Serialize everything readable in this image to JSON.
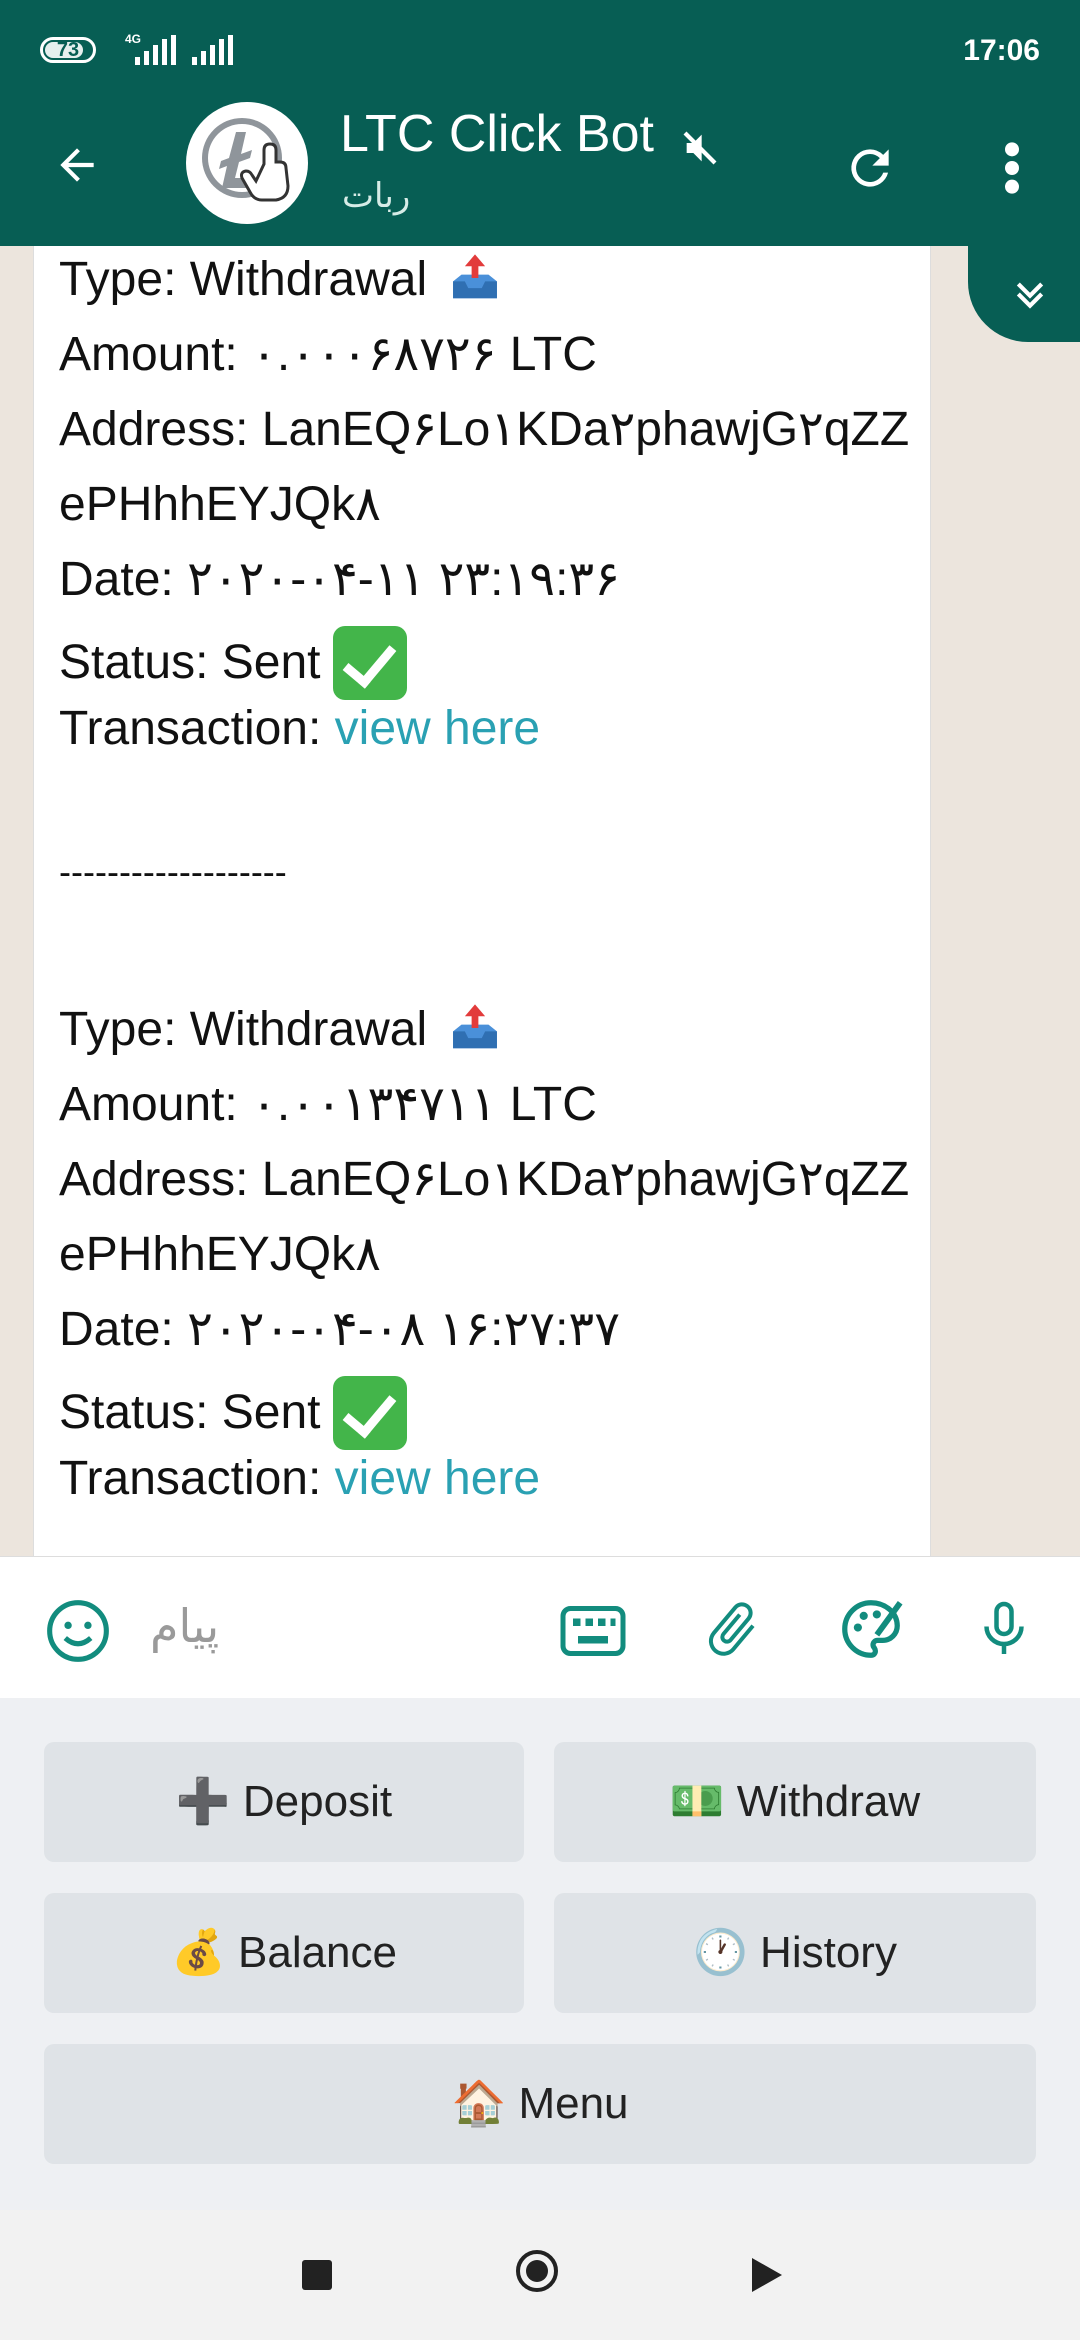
{
  "status_bar": {
    "battery": "73",
    "network": "4G",
    "time": "17:06"
  },
  "header": {
    "title": "LTC Click Bot",
    "subtitle": "ربات"
  },
  "messages": [
    {
      "type": "Type: Withdrawal",
      "amount": "Amount: ۰.۰۰۰۶۸۷۲۶ LTC",
      "address_line1": "Address: LanEQ۶Lo۱KDa۲phawjG۲qZZ",
      "address_line2": "ePHhhEYJQk۸",
      "date": "Date: ۲۰۲۰-۰۴-۱۱ ۲۳:۱۹:۳۶",
      "status": "Status: Sent",
      "transaction_label": "Transaction: ",
      "transaction_link": "view here"
    },
    {
      "type": "Type: Withdrawal",
      "amount": "Amount: ۰.۰۰۱۳۴۷۱۱ LTC",
      "address_line1": "Address: LanEQ۶Lo۱KDa۲phawjG۲qZZ",
      "address_line2": "ePHhhEYJQk۸",
      "date": "Date: ۲۰۲۰-۰۴-۰۸ ۱۶:۲۷:۳۷",
      "status": "Status: Sent",
      "transaction_label": "Transaction: ",
      "transaction_link": "view here"
    }
  ],
  "separator": "-------------------",
  "input": {
    "placeholder": "پیام"
  },
  "keyboard": {
    "deposit": "➕ Deposit",
    "withdraw": "💵 Withdraw",
    "balance": "💰 Balance",
    "history": "🕐 History",
    "menu": "🏠 Menu"
  },
  "colors": {
    "header": "#075e54",
    "link": "#2aa1b3",
    "accent": "#128c7e"
  }
}
